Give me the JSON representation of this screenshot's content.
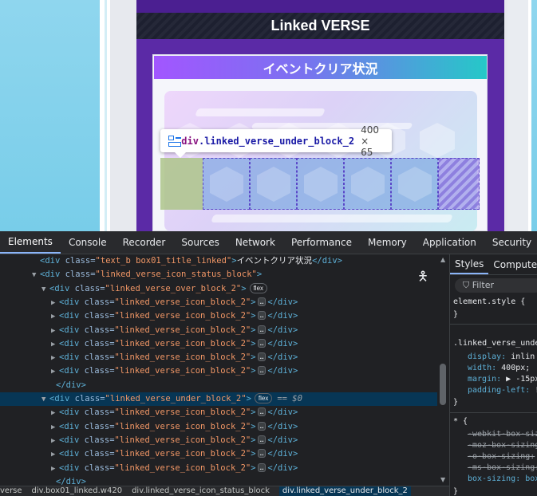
{
  "page": {
    "header_title": "Linked VERSE",
    "event_title": "イベントクリア状況",
    "colors": {
      "purple": "#5b2aa6",
      "highlight_margin": "#adc48a",
      "highlight_content": "#78a5e1"
    }
  },
  "tooltip": {
    "element": "div",
    "class_name": ".linked_verse_under_block_2",
    "size": "400 × 65"
  },
  "devtools": {
    "tabs": [
      "Elements",
      "Console",
      "Recorder",
      "Sources",
      "Network",
      "Performance",
      "Memory",
      "Application",
      "Security",
      "Lig"
    ],
    "active_tab": "Elements",
    "dom": {
      "title_row": {
        "class": "text_b box01_title_linked",
        "text": "イベントクリア状況"
      },
      "status_block_class": "linked_verse_icon_status_block",
      "over_block_class": "linked_verse_over_block_2",
      "under_block_class": "linked_verse_under_block_2",
      "icon_block_class": "linked_verse_icon_block_2",
      "flex_badge": "flex",
      "selected_marker": "== $0",
      "ellipsis": "…",
      "close_div": "</div>"
    },
    "breadcrumbs": [
      "verse",
      "div.box01_linked.w420",
      "div.linked_verse_icon_status_block",
      "div.linked_verse_under_block_2"
    ],
    "styles": {
      "tabs": [
        "Styles",
        "Compute"
      ],
      "filter_placeholder": "Filter",
      "element_style": "element.style {",
      "close_brace": "}",
      "rule_selector": ".linked_verse_unde",
      "rule_props": [
        {
          "name": "display",
          "value": "inlin"
        },
        {
          "name": "width",
          "value": "400px;"
        },
        {
          "name": "margin",
          "value": "▶ -15px"
        },
        {
          "name": "padding-left",
          "value": "!"
        }
      ],
      "universal_selector": "* {",
      "universal_props": [
        {
          "text": "-webkit-box-siz",
          "struck": true
        },
        {
          "text": "-moz-box-sizing",
          "struck": true
        },
        {
          "text": "-o-box-sizing:",
          "struck": true
        },
        {
          "text": "-ms-box-sizing:",
          "struck": true
        },
        {
          "text": "box-sizing: box",
          "struck": false
        }
      ]
    }
  }
}
